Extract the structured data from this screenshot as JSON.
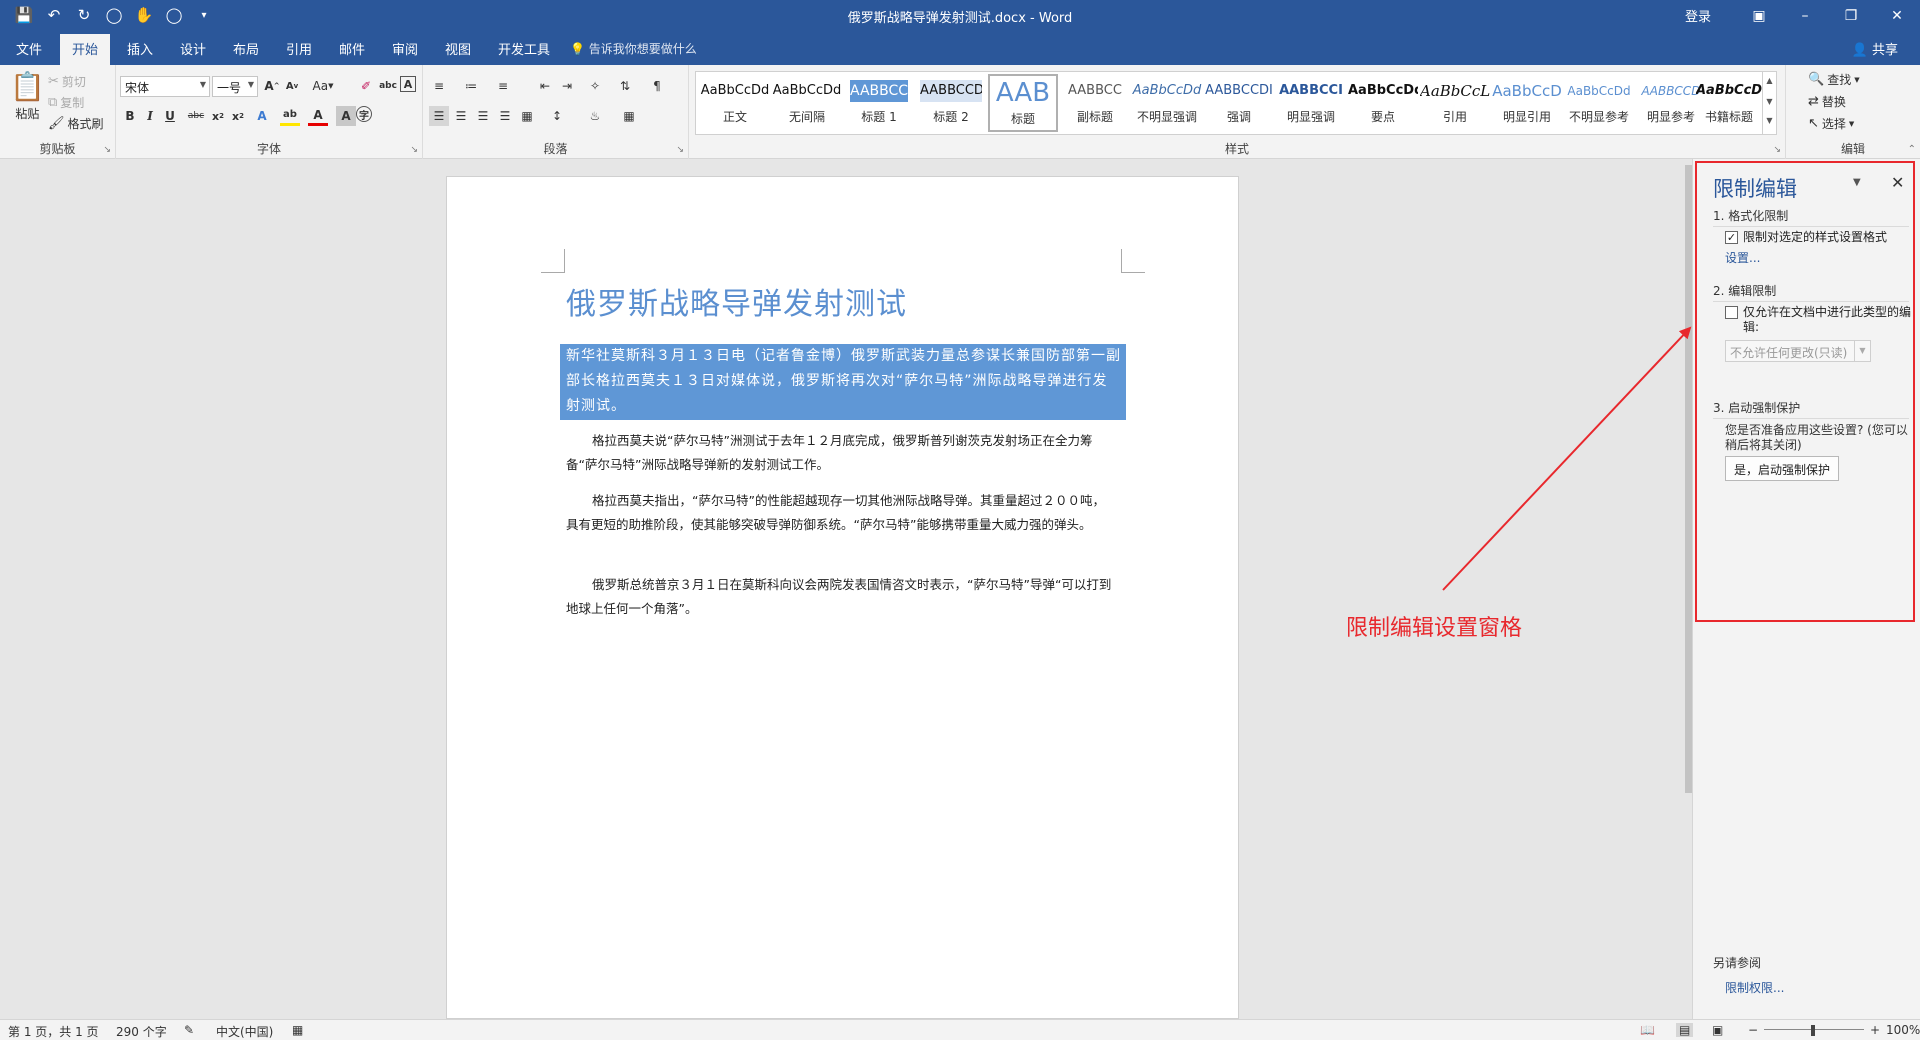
{
  "titlebar": {
    "doc_title": "俄罗斯战略导弹发射测试.docx - Word",
    "login": "登录",
    "qat": [
      "save-icon",
      "undo-icon",
      "redo-icon",
      "circle-icon",
      "touch-icon",
      "circle-icon",
      "customize-icon"
    ]
  },
  "tabs": {
    "items": [
      "文件",
      "开始",
      "插入",
      "设计",
      "布局",
      "引用",
      "邮件",
      "审阅",
      "视图",
      "开发工具"
    ],
    "active": "开始",
    "tell_me": "告诉我你想要做什么",
    "share": "共享"
  },
  "ribbon": {
    "clipboard": {
      "label": "剪贴板",
      "paste": "粘贴",
      "cut": "剪切",
      "copy": "复制",
      "format_painter": "格式刷"
    },
    "font": {
      "label": "字体",
      "font_name": "宋体",
      "font_size": "一号",
      "case": "Aa"
    },
    "paragraph": {
      "label": "段落"
    },
    "styles": {
      "label": "样式",
      "items": [
        {
          "preview": "AaBbCcDd",
          "name": "正文"
        },
        {
          "preview": "AaBbCcDd",
          "name": "无间隔"
        },
        {
          "preview": "AABBCC",
          "name": "标题 1"
        },
        {
          "preview": "AABBCCD",
          "name": "标题 2"
        },
        {
          "preview": "AAB",
          "name": "标题"
        },
        {
          "preview": "AABBCC",
          "name": "副标题"
        },
        {
          "preview": "AaBbCcDd",
          "name": "不明显强调"
        },
        {
          "preview": "AABBCCDI",
          "name": "强调"
        },
        {
          "preview": "AABBCCI",
          "name": "明显强调"
        },
        {
          "preview": "AaBbCcDd",
          "name": "要点"
        },
        {
          "preview": "AaBbCcL",
          "name": "引用"
        },
        {
          "preview": "AaBbCcD",
          "name": "明显引用"
        },
        {
          "preview": "AaBbCcDd",
          "name": "不明显参考"
        },
        {
          "preview": "AABBCCD",
          "name": "明显参考"
        },
        {
          "preview": "AaBbCcDd",
          "name": "书籍标题"
        }
      ]
    },
    "editing": {
      "label": "编辑",
      "find": "查找",
      "replace": "替换",
      "select": "选择"
    }
  },
  "document": {
    "title": "俄罗斯战略导弹发射测试",
    "lead": "新华社莫斯科３月１３日电（记者鲁金博）俄罗斯武装力量总参谋长兼国防部第一副部长格拉西莫夫１３日对媒体说，俄罗斯将再次对“萨尔马特”洲际战略导弹进行发射测试。",
    "paragraphs": [
      "格拉西莫夫说“萨尔马特”洲测试于去年１２月底完成，俄罗斯普列谢茨克发射场正在全力筹备“萨尔马特”洲际战略导弹新的发射测试工作。",
      "格拉西莫夫指出，“萨尔马特”的性能超越现存一切其他洲际战略导弹。其重量超过２００吨，具有更短的助推阶段，使其能够突破导弹防御系统。“萨尔马特”能够携带重量大威力强的弹头。",
      "俄罗斯总统普京３月１日在莫斯科向议会两院发表国情咨文时表示，“萨尔马特”导弹“可以打到地球上任何一个角落”。"
    ]
  },
  "pane": {
    "title": "限制编辑",
    "section1": "1. 格式化限制",
    "check1": "限制对选定的样式设置格式",
    "check1_checked": true,
    "settings_link": "设置...",
    "section2": "2. 编辑限制",
    "check2": "仅允许在文档中进行此类型的编辑:",
    "check2_checked": false,
    "edit_type": "不允许任何更改(只读)",
    "section3": "3. 启动强制保护",
    "prompt": "您是否准备应用这些设置? (您可以稍后将其关闭)",
    "start_button": "是，启动强制保护",
    "see_also": "另请参阅",
    "permissions_link": "限制权限..."
  },
  "annotation": {
    "text": "限制编辑设置窗格",
    "color": "#e8282d"
  },
  "status": {
    "page": "第 1 页，共 1 页",
    "words": "290 个字",
    "language": "中文(中国)",
    "zoom": "100%"
  },
  "colors": {
    "accent": "#2b579a",
    "selection": "#5f97d6",
    "heading": "#5b8fd0"
  }
}
